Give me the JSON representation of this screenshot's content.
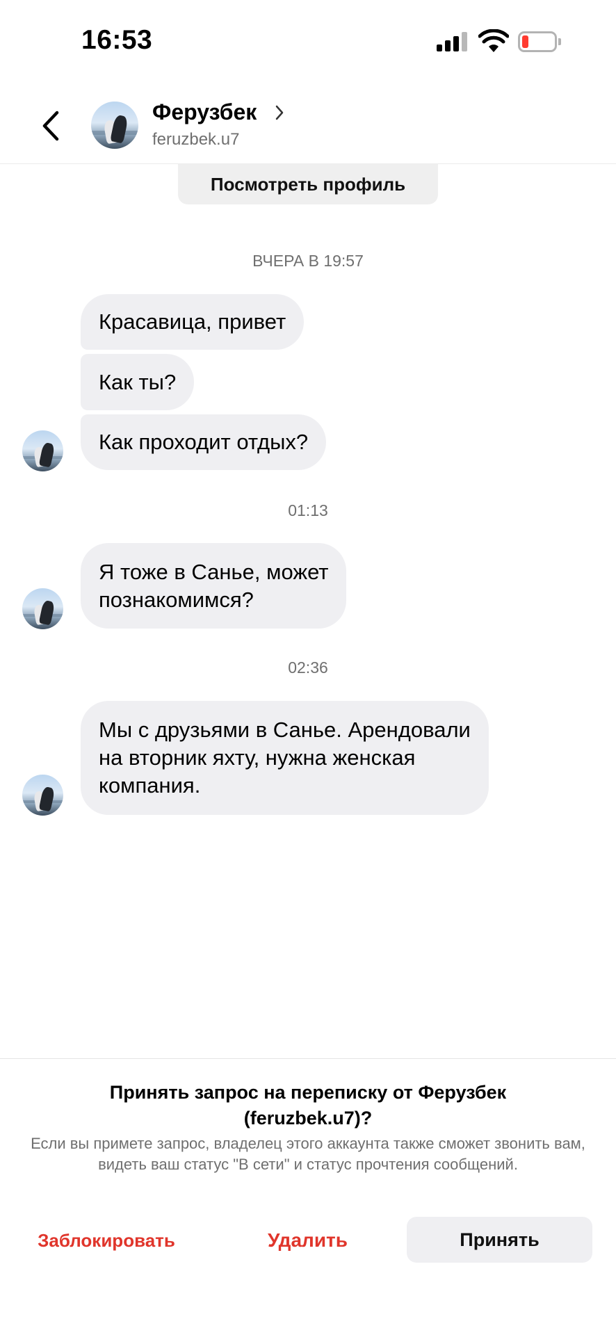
{
  "status_bar": {
    "time": "16:53",
    "icons": [
      "cellular-signal-icon",
      "wifi-icon",
      "battery-low-icon"
    ],
    "battery_color": "#ff3b30"
  },
  "header": {
    "back_icon": "chevron-left-icon",
    "name": "Ферузбек",
    "username": "feruzbek.u7",
    "name_chevron_icon": "chevron-right-icon"
  },
  "chat": {
    "view_profile_label": "Посмотреть профиль",
    "groups": [
      {
        "timestamp": "ВЧЕРА В 19:57",
        "messages": [
          "Красавица, привет",
          "Как ты?",
          "Как проходит отдых?"
        ]
      },
      {
        "timestamp": "01:13",
        "messages": [
          "Я тоже в Санье, может\nпознакомимся?"
        ]
      },
      {
        "timestamp": "02:36",
        "messages": [
          "Мы с друзьями в Санье. Арендовали\nна вторник яхту, нужна женская\nкомпания."
        ]
      }
    ]
  },
  "request": {
    "title": "Принять запрос на переписку от Ферузбек\n(feruzbek.u7)?",
    "description": "Если вы примете запрос, владелец этого аккаунта также сможет звонить вам, видеть ваш статус \"В сети\" и статус прочтения сообщений.",
    "block_label": "Заблокировать",
    "delete_label": "Удалить",
    "accept_label": "Принять",
    "danger_color": "#e0352b"
  }
}
